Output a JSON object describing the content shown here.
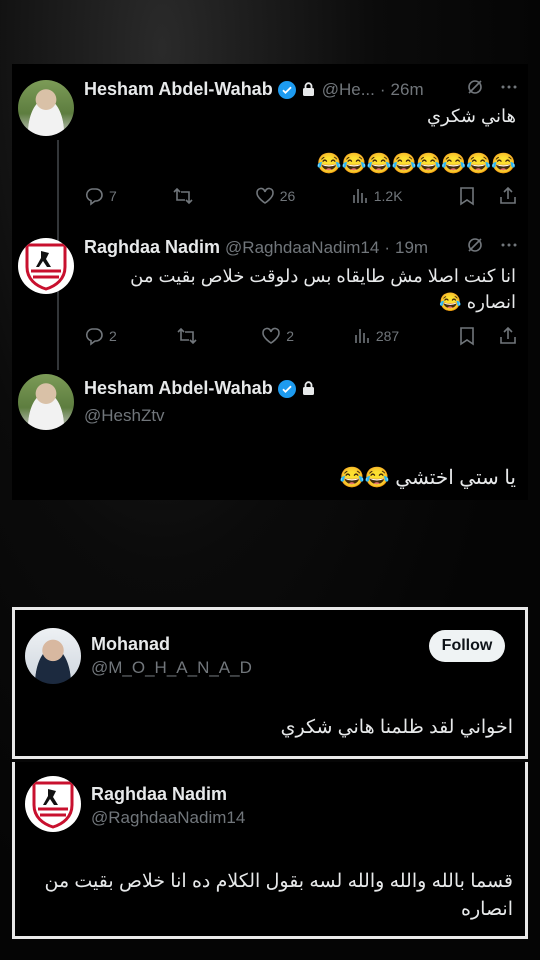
{
  "thread": {
    "tweet1": {
      "name": "Hesham Abdel-Wahab",
      "handle": "@He...",
      "time": "26m",
      "text": "هاني شكري",
      "emojis": "😂😂😂😂😂😂😂😂",
      "replies": "7",
      "retweets": "",
      "likes": "26",
      "views": "1.2K"
    },
    "tweet2": {
      "name": "Raghdaa Nadim",
      "handle": "@RaghdaaNadim14",
      "time": "19m",
      "text_line1": "انا كنت اصلا مش طايقاه بس دلوقت خلاص بقيت من",
      "text_line2": "انصاره 😂",
      "replies": "2",
      "retweets": "",
      "likes": "2",
      "views": "287"
    },
    "tweet3": {
      "name": "Hesham Abdel-Wahab",
      "handle": "@HeshZtv",
      "text": "يا ستي اختشي 😂😂"
    }
  },
  "quote1": {
    "name": "Mohanad",
    "handle": "@M_O_H_A_N_A_D",
    "follow_label": "Follow",
    "text": "اخواني لقد ظلمنا هاني شكري"
  },
  "quote2": {
    "name": "Raghdaa Nadim",
    "handle": "@RaghdaaNadim14",
    "text_line1": "قسما بالله والله والله لسه بقول الكلام ده انا خلاص بقيت من",
    "text_line2": "انصاره"
  },
  "icons": {
    "verified": "verified-badge-icon",
    "lock": "lock-icon",
    "grok": "grok-icon",
    "more": "more-icon",
    "reply": "reply-icon",
    "retweet": "retweet-icon",
    "like": "heart-icon",
    "views": "views-icon",
    "bookmark": "bookmark-icon",
    "share": "share-icon"
  },
  "colors": {
    "accent": "#1d9bf0",
    "muted": "#71767b",
    "text": "#e7e9ea",
    "background": "#000000",
    "frame": "#e9e9e9"
  }
}
